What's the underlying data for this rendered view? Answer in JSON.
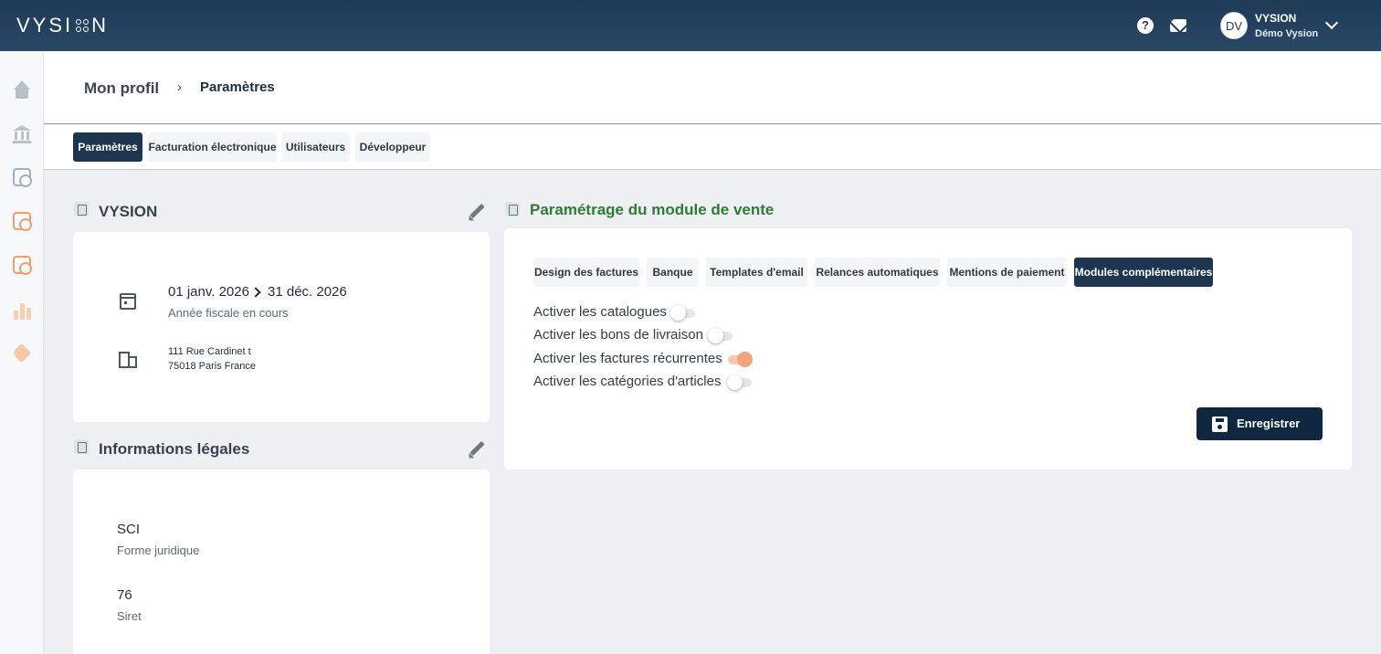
{
  "app": {
    "logo_text_left": "VYSI",
    "logo_text_right": "N"
  },
  "topbar": {
    "help_glyph": "?",
    "user_initials": "DV",
    "user_name": "VYSION",
    "user_org": "Démo Vysion"
  },
  "breadcrumb": {
    "parent": "Mon profil",
    "separator": "›",
    "current": "Paramètres"
  },
  "tabs": [
    {
      "label": "Paramètres",
      "active": true
    },
    {
      "label": "Facturation électronique",
      "active": false
    },
    {
      "label": "Utilisateurs",
      "active": false
    },
    {
      "label": "Développeur",
      "active": false
    }
  ],
  "company": {
    "title": "VYSION",
    "fiscal_start": "01 janv. 2026",
    "fiscal_end": "31 déc. 2026",
    "fiscal_caption": "Année fiscale en cours",
    "address_line1": "111 Rue Cardinet t",
    "address_line2": "75018 Paris France"
  },
  "legal": {
    "title": "Informations légales",
    "legal_form": "SCI",
    "legal_form_caption": "Forme juridique",
    "siret": "76",
    "siret_caption": "Siret"
  },
  "sales_module": {
    "title": "Paramétrage du module de vente",
    "title_color": "#2e7d32",
    "tabs": [
      {
        "label": "Design des factures",
        "active": false
      },
      {
        "label": "Banque",
        "active": false
      },
      {
        "label": "Templates d'email",
        "active": false
      },
      {
        "label": "Relances automatiques",
        "active": false
      },
      {
        "label": "Mentions de paiement",
        "active": false
      },
      {
        "label": "Modules complémentaires",
        "active": true
      }
    ],
    "toggles": [
      {
        "label": "Activer les catalogues",
        "on": false
      },
      {
        "label": "Activer les bons de livraison",
        "on": false
      },
      {
        "label": "Activer les factures récurrentes",
        "on": true
      },
      {
        "label": "Activer les catégories d'articles",
        "on": false
      }
    ],
    "save_label": "Enregistrer"
  },
  "colors": {
    "accent": "#1d3550",
    "toggle_on": "#f0a37c",
    "sidebar_active": "#f0a070"
  }
}
